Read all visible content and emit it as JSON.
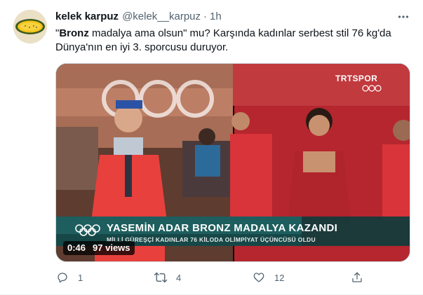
{
  "tweet": {
    "display_name": "kelek karpuz",
    "handle": "@kelek__karpuz",
    "separator": "·",
    "time": "1h",
    "text_part1": "\"",
    "text_bold": "Bronz",
    "text_part2": " madalya ama olsun\" mu?  Karşında kadınlar serbest stil 76 kg'da Dünya'nın en iyi 3. sporcusu duruyor."
  },
  "media": {
    "channel": "TRTSPOR",
    "headline": "YASEMİN ADAR BRONZ MADALYA KAZANDI",
    "subheadline": "MİLLİ GÜREŞÇİ KADINLAR 76 KİLODA OLİMPİYAT ÜÇÜNCÜSÜ OLDU",
    "duration": "0:46",
    "views": "97 views"
  },
  "actions": {
    "reply_count": "1",
    "retweet_count": "4",
    "like_count": "12",
    "share_count": ""
  },
  "colors": {
    "text_primary": "#0f1419",
    "text_secondary": "#536471",
    "lower_third": "#1e5e5e",
    "border": "#cfd9de"
  },
  "icons": [
    "more-icon",
    "reply-icon",
    "retweet-icon",
    "like-icon",
    "share-icon",
    "olympic-rings-icon"
  ]
}
